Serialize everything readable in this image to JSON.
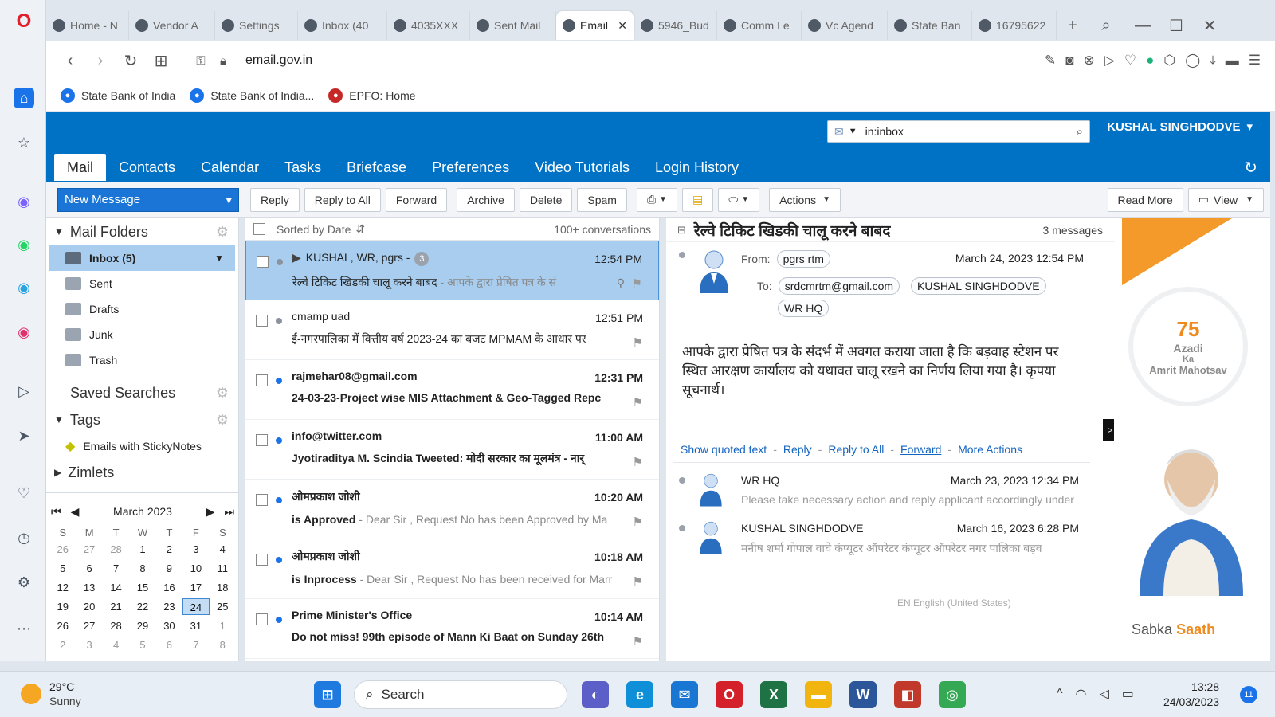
{
  "browser": {
    "tabs": [
      "Home - N",
      "Vendor A",
      "Settings",
      "Inbox (40",
      "4035XXX",
      "Sent Mail",
      "Email",
      "5946_Bud",
      "Comm Le",
      "Vc Agend",
      "State Ban",
      "16795622"
    ],
    "url": "email.gov.in",
    "bookmarks": [
      "State Bank of India",
      "State Bank of India...",
      "EPFO: Home"
    ]
  },
  "header": {
    "search_value": "in:inbox",
    "user": "KUSHAL SINGHDODVE",
    "tabs": [
      "Mail",
      "Contacts",
      "Calendar",
      "Tasks",
      "Briefcase",
      "Preferences",
      "Video Tutorials",
      "Login History"
    ]
  },
  "toolbar": {
    "new_message": "New Message",
    "buttons": [
      "Reply",
      "Reply to All",
      "Forward",
      "Archive",
      "Delete",
      "Spam"
    ],
    "actions": "Actions",
    "read_more": "Read More",
    "view": "View"
  },
  "sidebar": {
    "mail_folders": "Mail Folders",
    "folders": [
      "Inbox (5)",
      "Sent",
      "Drafts",
      "Junk",
      "Trash"
    ],
    "saved_searches": "Saved Searches",
    "tags": "Tags",
    "tag_items": [
      "Emails with StickyNotes"
    ],
    "zimlets": "Zimlets"
  },
  "calendar": {
    "month": "March 2023",
    "weekdays": [
      "S",
      "M",
      "T",
      "W",
      "T",
      "F",
      "S"
    ],
    "days": [
      "26",
      "27",
      "28",
      "1",
      "2",
      "3",
      "4",
      "5",
      "6",
      "7",
      "8",
      "9",
      "10",
      "11",
      "12",
      "13",
      "14",
      "15",
      "16",
      "17",
      "18",
      "19",
      "20",
      "21",
      "22",
      "23",
      "24",
      "25",
      "26",
      "27",
      "28",
      "29",
      "30",
      "31",
      "1",
      "2",
      "3",
      "4",
      "5",
      "6",
      "7",
      "8"
    ],
    "today": "24"
  },
  "list": {
    "sort_label": "Sorted by Date",
    "count": "100+ conversations",
    "items": [
      {
        "sender": "KUSHAL, WR, pgrs -",
        "badge": "3",
        "time": "12:54 PM",
        "subject": "रेल्वे टिकिट खिडकी चालू करने बाबद",
        "preview": " - आपके द्वारा प्रेषित पत्र के सं"
      },
      {
        "sender": "cmamp uad",
        "time": "12:51 PM",
        "subject": "ई-नगरपालिका में वित्तीय वर्ष 2023-24 का बजट MPMAM के आधार पर",
        "preview": ""
      },
      {
        "sender": "rajmehar08@gmail.com",
        "time": "12:31 PM",
        "subject": "24-03-23-Project wise MIS Attachment & Geo-Tagged Repc",
        "preview": ""
      },
      {
        "sender": "info@twitter.com",
        "time": "11:00 AM",
        "subject": "Jyotiraditya M. Scindia Tweeted: मोदी सरकार का मूलमंत्र - नार्",
        "preview": ""
      },
      {
        "sender": "ओमप्रकाश जोशी",
        "time": "10:20 AM",
        "subject": "is Approved",
        "preview": " - Dear Sir , Request No has been Approved by Ma"
      },
      {
        "sender": "ओमप्रकाश जोशी",
        "time": "10:18 AM",
        "subject": "is Inprocess",
        "preview": " - Dear Sir , Request No has been received for Marr"
      },
      {
        "sender": "Prime Minister's Office",
        "time": "10:14 AM",
        "subject": "Do not miss! 99th episode of Mann Ki Baat on Sunday 26th",
        "preview": ""
      }
    ]
  },
  "reading": {
    "subject": "रेल्वे टिकिट खिडकी चालू करने बाबद",
    "messages_count": "3 messages",
    "from_label": "From:",
    "from": "pgrs rtm",
    "to_label": "To:",
    "to": [
      "srdcmrtm@gmail.com",
      "KUSHAL SINGHDODVE",
      "WR HQ"
    ],
    "date": "March 24, 2023 12:54 PM",
    "body": "आपके द्वारा प्रेषित पत्र के संदर्भ में अवगत कराया जाता है कि बड़वाह स्टेशन पर स्थित आरक्षण कार्यालय को यथावत चालू रखने का निर्णय लिया गया है। कृपया सूचनार्थ।",
    "links": [
      "Show quoted text",
      "Reply",
      "Reply to All",
      "Forward",
      "More Actions"
    ],
    "thread": [
      {
        "sender": "WR HQ",
        "date": "March 23, 2023 12:34 PM",
        "preview": "Please take necessary action and reply applicant accordingly under"
      },
      {
        "sender": "KUSHAL SINGHDODVE",
        "date": "March 16, 2023 6:28 PM",
        "preview": "मनीष शर्मा गोपाल वाघे कंप्यूटर ऑपरेटर कंप्यूटर ऑपरेटर नगर पालिका बड़व"
      }
    ],
    "language": "EN English (United States)"
  },
  "ad": {
    "azadi_line1": "Azadi",
    "azadi_ka": "Ka",
    "azadi_line2": "Amrit Mahotsav",
    "sabka": "Sabka",
    "saath": "Saath"
  },
  "taskbar": {
    "temp": "29°C",
    "weather": "Sunny",
    "search": "Search",
    "time": "13:28",
    "date": "24/03/2023",
    "notif": "11"
  }
}
